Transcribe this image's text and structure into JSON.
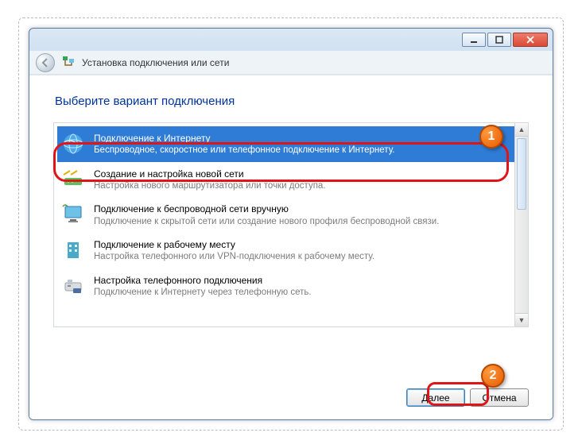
{
  "window": {
    "title": "Установка подключения или сети"
  },
  "heading": "Выберите вариант подключения",
  "options": [
    {
      "label": "Подключение к Интернету",
      "desc": "Беспроводное, скоростное или телефонное подключение к Интернету.",
      "selected": true,
      "icon": "globe"
    },
    {
      "label": "Создание и настройка новой сети",
      "desc": "Настройка нового маршрутизатора или точки доступа.",
      "selected": false,
      "icon": "router"
    },
    {
      "label": "Подключение к беспроводной сети вручную",
      "desc": "Подключение к скрытой сети или создание нового профиля беспроводной связи.",
      "selected": false,
      "icon": "monitor"
    },
    {
      "label": "Подключение к рабочему месту",
      "desc": "Настройка телефонного или VPN-подключения к рабочему месту.",
      "selected": false,
      "icon": "building"
    },
    {
      "label": "Настройка телефонного подключения",
      "desc": "Подключение к Интернету через телефонную сеть.",
      "selected": false,
      "icon": "dialup"
    }
  ],
  "buttons": {
    "next": "Далее",
    "cancel": "Отмена"
  },
  "markers": {
    "first": "1",
    "second": "2"
  }
}
